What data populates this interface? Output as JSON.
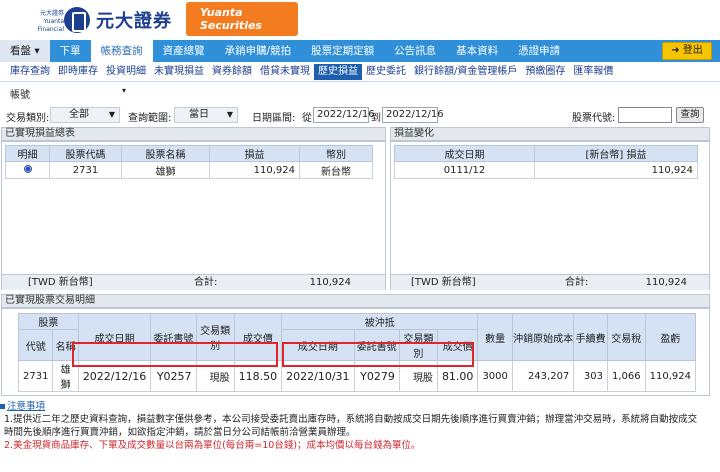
{
  "header": {
    "brand_small": "元大證券 Yuanta Financial",
    "brand_cn": "元大證券",
    "brand_en": "Yuanta Securities"
  },
  "nav1": {
    "items": [
      "看盤",
      "下單",
      "帳務查詢",
      "資產總覽",
      "承銷申購/競拍",
      "股票定期定額",
      "公告訊息",
      "基本資料",
      "憑證申請"
    ],
    "first_caret": "▾",
    "logout": "登出"
  },
  "nav2": {
    "items": [
      "庫存查詢",
      "即時庫存",
      "投資明細",
      "未實現損益",
      "資券餘額",
      "借貸未實現",
      "歷史損益",
      "歷史委託",
      "銀行餘額/資金管理帳戶",
      "預繳圈存",
      "匯率報價"
    ]
  },
  "account": {
    "label": "帳號"
  },
  "filters": {
    "trade_type_label": "交易類別:",
    "trade_type_value": "全部",
    "query_range_label": "查詢範圍:",
    "query_range_value": "當日",
    "date_range_label": "日期區間:",
    "from_label": "從",
    "date_from": "2022/12/16",
    "to_label": "到",
    "date_to": "2022/12/16",
    "stock_code_label": "股票代號:",
    "query_button": "查詢"
  },
  "realized_summary": {
    "title": "已實現損益總表",
    "headers": [
      "明細",
      "股票代碼",
      "股票名稱",
      "損益",
      "幣別"
    ],
    "rows": [
      {
        "code": "2731",
        "name": "雄獅",
        "pl": "110,924",
        "currency": "新台幣"
      }
    ],
    "total_currency": "[TWD 新台幣]",
    "total_label": "合計:",
    "total_value": "110,924"
  },
  "pl_change": {
    "title": "損益變化",
    "headers": [
      "成交日期",
      "[新台幣] 損益"
    ],
    "rows": [
      {
        "date": "0111/12",
        "pl": "110,924"
      }
    ],
    "total_currency": "[TWD 新台幣]",
    "total_label": "合計:",
    "total_value": "110,924"
  },
  "detail": {
    "title": "已實現股票交易明細",
    "group_stock": "股票",
    "group_offset": "被沖抵",
    "headers": {
      "code": "代號",
      "name": "名稱",
      "trade_date": "成交日期",
      "order_no": "委託書號",
      "trade_type": "交易類別",
      "price": "成交價",
      "o_trade_date": "成交日期",
      "o_order_no": "委託書號",
      "o_trade_type": "交易類別",
      "o_price": "成交價",
      "qty": "數量",
      "orig_cost": "沖銷原始成本",
      "fee": "手續費",
      "tax": "交易稅",
      "profit": "盈虧"
    },
    "row": {
      "code": "2731",
      "name": "雄獅",
      "trade_date": "2022/12/16",
      "order_no": "Y0257",
      "trade_type": "現股",
      "price": "118.50",
      "o_trade_date": "2022/10/31",
      "o_order_no": "Y0279",
      "o_trade_type": "現股",
      "o_price": "81.00",
      "qty": "3000",
      "orig_cost": "243,207",
      "fee": "303",
      "tax": "1,066",
      "profit": "110,924"
    }
  },
  "notes": {
    "title": "注意事項",
    "line1": "1.提供近二年之歷史資料查詢，損益數字僅供參考，本公司接受委託賣出庫存時，系統將自動按成交日期先後順序進行買賣沖銷；辦理當沖交易時，系統將自動按成交",
    "line1b": "時間先後順序進行買賣沖銷，如欲指定沖銷，請於當日分公司結帳前洽營業員辦理。",
    "line2": "2.美金現貨商品庫存、下單及成交數量以台兩為單位(每台兩=10台錢)；成本均價以每台錢為單位。"
  },
  "colors": {
    "nav_blue": "#2f8fd8",
    "highlight_red": "#e0252b",
    "logout_yellow": "#f6c400",
    "brand_orange": "#f47c20"
  }
}
